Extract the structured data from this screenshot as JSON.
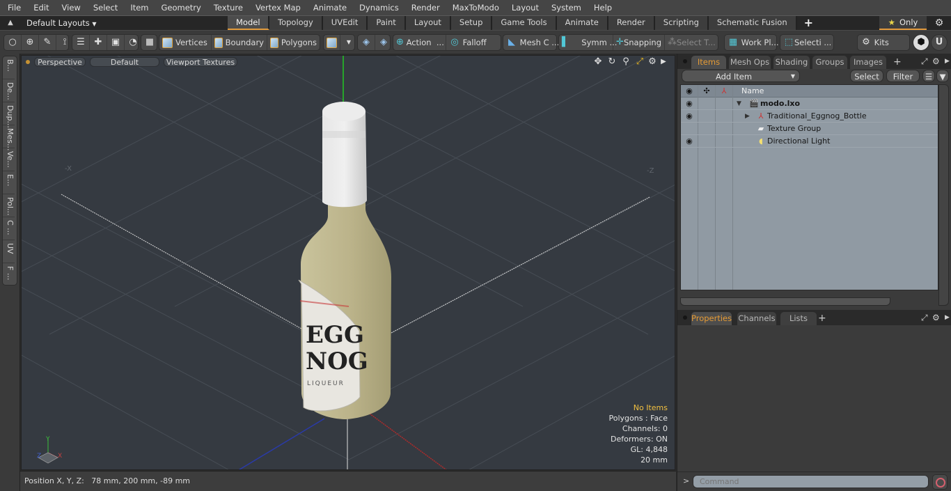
{
  "menu": [
    "File",
    "Edit",
    "View",
    "Select",
    "Item",
    "Geometry",
    "Texture",
    "Vertex Map",
    "Animate",
    "Dynamics",
    "Render",
    "MaxToModo",
    "Layout",
    "System",
    "Help"
  ],
  "layoutbar": {
    "layouts_label": "Default Layouts",
    "tabs": [
      "Model",
      "Topology",
      "UVEdit",
      "Paint",
      "Layout",
      "Setup",
      "Game Tools",
      "Animate",
      "Render",
      "Scripting",
      "Schematic Fusion"
    ],
    "active_tab": "Model",
    "add_tab": "+",
    "only_label": "Only"
  },
  "toolbar": {
    "vertices": "Vertices",
    "boundary": "Boundary",
    "polygons": "Polygons",
    "action": "Action",
    "falloff": "Falloff",
    "mesh_constraints": "Mesh C ...",
    "symmetry": "Symm ...",
    "snapping": "Snapping",
    "select_through": "Select T...",
    "work_plane": "Work Pl...",
    "selection_sets": "Selecti ...",
    "kits": "Kits",
    "ellipsis": "..."
  },
  "left_tabs": [
    "B...",
    "De...",
    "Dup...",
    "Mes...",
    "Ve...",
    "E...",
    "Pol...",
    "C ...",
    "UV",
    "F ..."
  ],
  "viewport": {
    "view_mode": "Perspective",
    "shading": "Default",
    "textures": "Viewport Textures",
    "axis_labels": {
      "neg_x": "-X",
      "neg_z": "-Z",
      "y": "Y",
      "x": "X",
      "z": "Z"
    },
    "label_text": {
      "line1": "EGG",
      "line2": "NOG",
      "line3": "LIQUEUR"
    },
    "info": {
      "selection": "No Items",
      "polygons": "Polygons : Face",
      "channels": "Channels: 0",
      "deformers": "Deformers: ON",
      "gl": "GL: 4,848",
      "scale": "20 mm"
    }
  },
  "status": {
    "position": "Position X, Y, Z:   78 mm, 200 mm, -89 mm"
  },
  "items_panel": {
    "tabs": [
      "Items",
      "Mesh Ops",
      "Shading",
      "Groups",
      "Images"
    ],
    "active_tab": "Items",
    "add_item": "Add Item",
    "select": "Select",
    "filter": "Filter",
    "column_name": "Name",
    "items": [
      {
        "name": "modo.lxo",
        "type": "scene",
        "expanded": true
      },
      {
        "name": "Traditional_Eggnog_Bottle",
        "type": "mesh",
        "expanded": false
      },
      {
        "name": "Texture Group",
        "type": "texture-group"
      },
      {
        "name": "Directional Light",
        "type": "light"
      }
    ]
  },
  "properties_panel": {
    "tabs": [
      "Properties",
      "Channels",
      "Lists"
    ],
    "active_tab": "Properties"
  },
  "command": {
    "prompt": ">",
    "placeholder": "Command"
  },
  "colors": {
    "accent": "#e29a3b",
    "viewport_bg": "#353a41",
    "highlight_text": "#f2c040"
  }
}
